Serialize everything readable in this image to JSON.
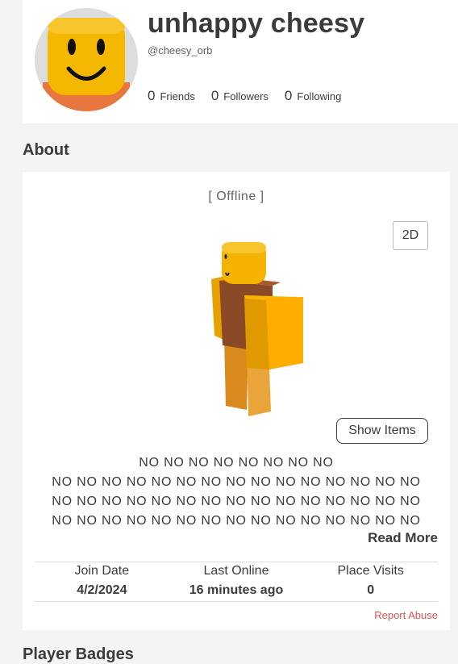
{
  "profile": {
    "display_name": "unhappy cheesy",
    "username": "@cheesy_orb",
    "stats": [
      {
        "count": "0",
        "label": "Friends"
      },
      {
        "count": "0",
        "label": "Followers"
      },
      {
        "count": "0",
        "label": "Following"
      }
    ]
  },
  "about": {
    "title": "About",
    "status": "[ Offline ]",
    "view_toggle_label": "2D",
    "show_items_label": "Show Items",
    "description_lines": [
      "NO NO NO NO NO NO NO NO",
      "NO NO NO NO NO NO NO NO NO NO NO NO NO NO NO",
      "NO NO NO NO NO NO NO NO NO NO NO NO NO NO NO",
      "NO NO NO NO NO NO NO NO NO NO NO NO NO NO NO"
    ],
    "read_more_label": "Read More",
    "info": [
      {
        "label": "Join Date",
        "value": "4/2/2024"
      },
      {
        "label": "Last Online",
        "value": "16 minutes ago"
      },
      {
        "label": "Place Visits",
        "value": "0"
      }
    ],
    "report_label": "Report Abuse"
  },
  "next_section_title": "Player Badges",
  "colors": {
    "accent_red": "#e05454",
    "avatar_yellow": "#f5b800",
    "torso_orange": "#e8763f"
  }
}
